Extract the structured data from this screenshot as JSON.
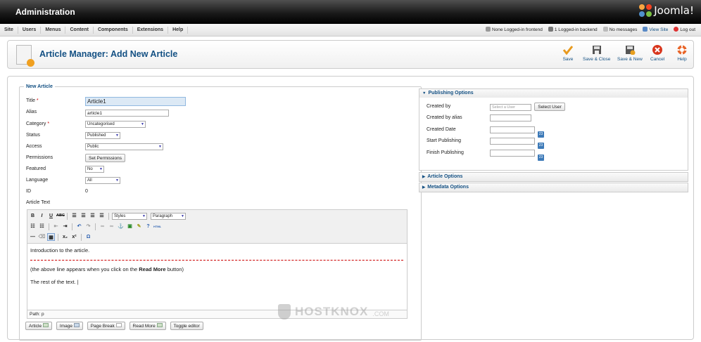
{
  "header": {
    "title": "Administration",
    "logo_text": "Joomla!"
  },
  "menu": [
    "Site",
    "Users",
    "Menus",
    "Content",
    "Components",
    "Extensions",
    "Help"
  ],
  "status": {
    "frontend": "None Logged-in frontend",
    "backend": "1 Logged-in backend",
    "messages": "No messages",
    "view_site": "View Site",
    "logout": "Log out"
  },
  "page": {
    "title": "Article Manager: Add New Article"
  },
  "toolbar": {
    "save": "Save",
    "save_close": "Save & Close",
    "save_new": "Save & New",
    "cancel": "Cancel",
    "help": "Help"
  },
  "form": {
    "legend": "New Article",
    "title_label": "Title",
    "title_value": "Article1",
    "alias_label": "Alias",
    "alias_value": "article1",
    "category_label": "Category",
    "category_value": "Uncategorised",
    "status_label": "Status",
    "status_value": "Published",
    "access_label": "Access",
    "access_value": "Public",
    "permissions_label": "Permissions",
    "permissions_button": "Set Permissions",
    "featured_label": "Featured",
    "featured_value": "No",
    "language_label": "Language",
    "language_value": "All",
    "id_label": "ID",
    "id_value": "0",
    "article_text_label": "Article Text"
  },
  "editor": {
    "styles": "Styles",
    "format": "Paragraph",
    "intro": "Introduction to the article.",
    "readmore_note_before": "(the above line appears when you click on the ",
    "readmore_note_bold": "Read More",
    "readmore_note_after": " button)",
    "rest": "The rest of the text.",
    "path": "Path: p",
    "buttons": [
      "Article",
      "Image",
      "Page Break",
      "Read More",
      "Toggle editor"
    ]
  },
  "publishing": {
    "title": "Publishing Options",
    "created_by": "Created by",
    "select_user_placeholder": "Select a User",
    "select_user_button": "Select User",
    "created_by_alias": "Created by alias",
    "created_date": "Created Date",
    "start_publishing": "Start Publishing",
    "finish_publishing": "Finish Publishing"
  },
  "panels": {
    "article_options": "Article Options",
    "metadata_options": "Metadata Options"
  },
  "watermark": {
    "text": "HOSTKNOX",
    "suffix": ".COM"
  },
  "colors": {
    "accent": "#135083",
    "topbar": "#1a1a1a"
  }
}
